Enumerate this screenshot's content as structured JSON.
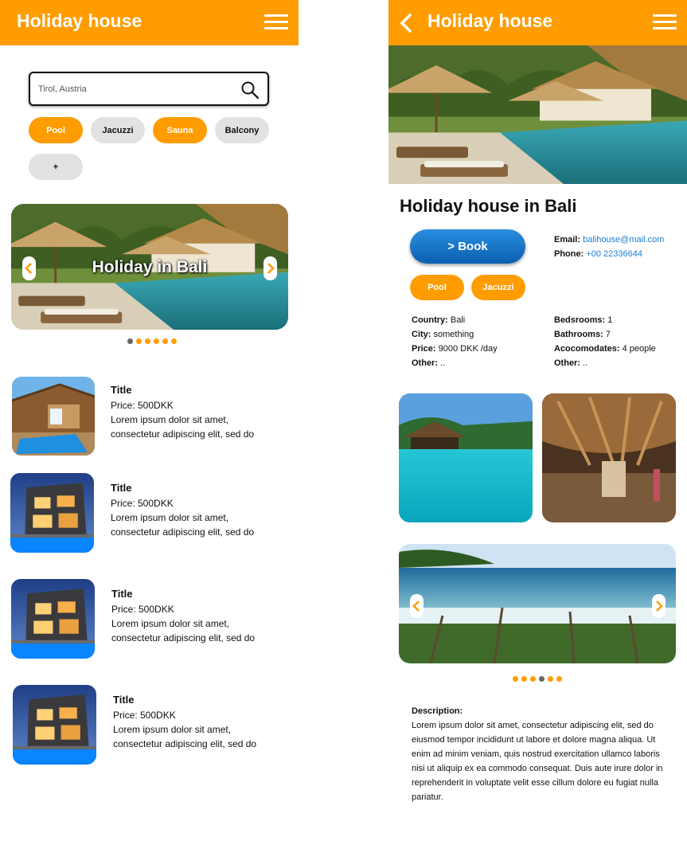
{
  "colors": {
    "accent": "#ff9c00",
    "link": "#1a7fd4",
    "book_button": "#1571c4",
    "chip_inactive": "#e2e2e2"
  },
  "left": {
    "app_title": "Holiday house",
    "search": {
      "placeholder": "Tirol, Austria"
    },
    "filters": [
      {
        "label": "Pool",
        "active": true
      },
      {
        "label": "Jacuzzi",
        "active": false
      },
      {
        "label": "Sauna",
        "active": true
      },
      {
        "label": "Balcony",
        "active": false
      },
      {
        "label": "+",
        "active": false
      }
    ],
    "featured": {
      "caption": "Holiday in Bali",
      "slides": 6,
      "active_slide": 1
    },
    "listings": [
      {
        "title": "Title",
        "price": "Price: 500DKK",
        "desc": "Lorem ipsum dolor sit amet, consectetur adipiscing elit, sed do",
        "image": "wooden-house-pool"
      },
      {
        "title": "Title",
        "price": "Price: 500DKK",
        "desc": "Lorem ipsum dolor sit amet, consectetur adipiscing elit, sed do",
        "image": "modern-villa-night"
      },
      {
        "title": "Title",
        "price": "Price: 500DKK",
        "desc": "Lorem ipsum dolor sit amet, consectetur adipiscing elit, sed do",
        "image": "modern-villa-night"
      },
      {
        "title": "Title",
        "price": "Price: 500DKK",
        "desc": "Lorem ipsum dolor sit amet, consectetur adipiscing elit, sed do",
        "image": "modern-villa-night"
      }
    ]
  },
  "right": {
    "app_title": "Holiday house",
    "heading": "Holiday house in Bali",
    "book_label": "> Book",
    "contact": {
      "email_label": "Email:",
      "email": "balihouse@mail.com",
      "phone_label": "Phone:",
      "phone": "+00 22336644"
    },
    "amenities": [
      "Pool",
      "Jacuzzi"
    ],
    "details_left": [
      {
        "label": "Country:",
        "value": "Bali"
      },
      {
        "label": "City:",
        "value": "something"
      },
      {
        "label": "Price:",
        "value": "9000 DKK /day"
      },
      {
        "label": "Other:",
        "value": ".."
      }
    ],
    "details_right": [
      {
        "label": "Bedsrooms:",
        "value": "1"
      },
      {
        "label": "Bathrooms:",
        "value": "7"
      },
      {
        "label": "Acocomodates:",
        "value": "4 people"
      },
      {
        "label": "Other:",
        "value": ".."
      }
    ],
    "gallery": {
      "slides": 6,
      "active_slide": 4
    },
    "description_heading": "Description:",
    "description": "Lorem ipsum dolor sit amet, consectetur adipiscing elit, sed do eiusmod tempor incididunt ut labore et dolore magna aliqua. Ut enim ad minim veniam, quis nostrud exercitation ullamco laboris nisi ut aliquip ex ea commodo consequat. Duis aute irure dolor in reprehenderit in voluptate velit esse cillum dolore eu fugiat nulla pariatur."
  }
}
